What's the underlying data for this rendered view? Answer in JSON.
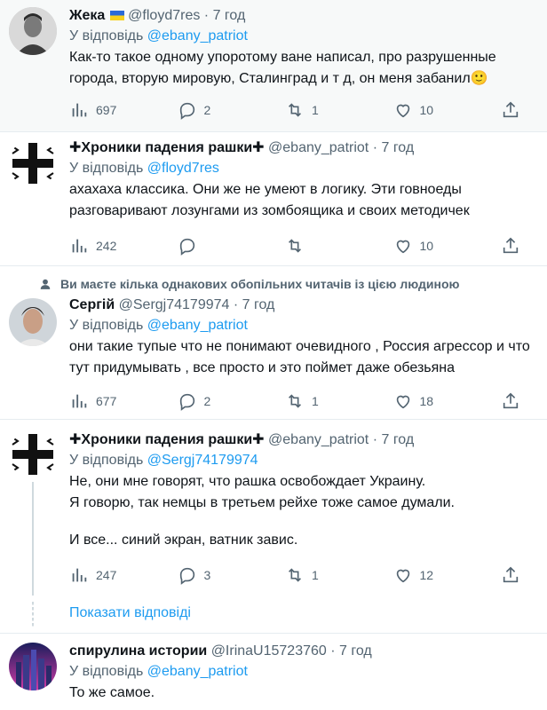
{
  "reply_prefix": "У відповідь",
  "dot": "·",
  "show_replies": "Показати відповіді",
  "social_context": "Ви маєте кілька однакових обопільних читачів із цією людиною",
  "tweets": [
    {
      "name": "Жека",
      "name_flag": "ukraine-flag",
      "handle": "@floyd7res",
      "time": "7 год",
      "reply_to": "@ebany_patriot",
      "text": [
        "Как-то такое одному упоротому ване написал, про разрушенные города, вторую мировую, Сталинград и т д, он меня забанил🙂"
      ],
      "views": "697",
      "replies": "2",
      "retweets": "1",
      "likes": "10"
    },
    {
      "name": "✚Хроники падения рашки✚",
      "handle": "@ebany_patriot",
      "time": "7 год",
      "reply_to": "@floyd7res",
      "text": [
        "ахахаха классика. Они же не умеют в логику. Эти говноеды разговаривают лозунгами из зомбоящика и своих методичек"
      ],
      "views": "242",
      "replies": "",
      "retweets": "",
      "likes": "10"
    },
    {
      "name": "Сергій",
      "handle": "@Sergj74179974",
      "time": "7 год",
      "reply_to": "@ebany_patriot",
      "text": [
        "они такие тупые что не понимают очевидного , Россия агрессор и что тут придумывать , все просто и это поймет даже обезьяна"
      ],
      "views": "677",
      "replies": "2",
      "retweets": "1",
      "likes": "18"
    },
    {
      "name": "✚Хроники падения рашки✚",
      "handle": "@ebany_patriot",
      "time": "7 год",
      "reply_to": "@Sergj74179974",
      "text": [
        "Не, они мне говорят, что рашка освобождает Украину.",
        "Я говорю, так немцы в третьем рейхе тоже самое думали.",
        "",
        "И все... синий экран, ватник завис."
      ],
      "views": "247",
      "replies": "3",
      "retweets": "1",
      "likes": "12"
    },
    {
      "name": "спирулина истории",
      "handle": "@IrinaU15723760",
      "time": "7 год",
      "reply_to": "@ebany_patriot",
      "text": [
        "То же самое."
      ]
    }
  ],
  "colors": {
    "accent": "#1d9bf0",
    "muted": "#536471",
    "text": "#0f1419"
  }
}
